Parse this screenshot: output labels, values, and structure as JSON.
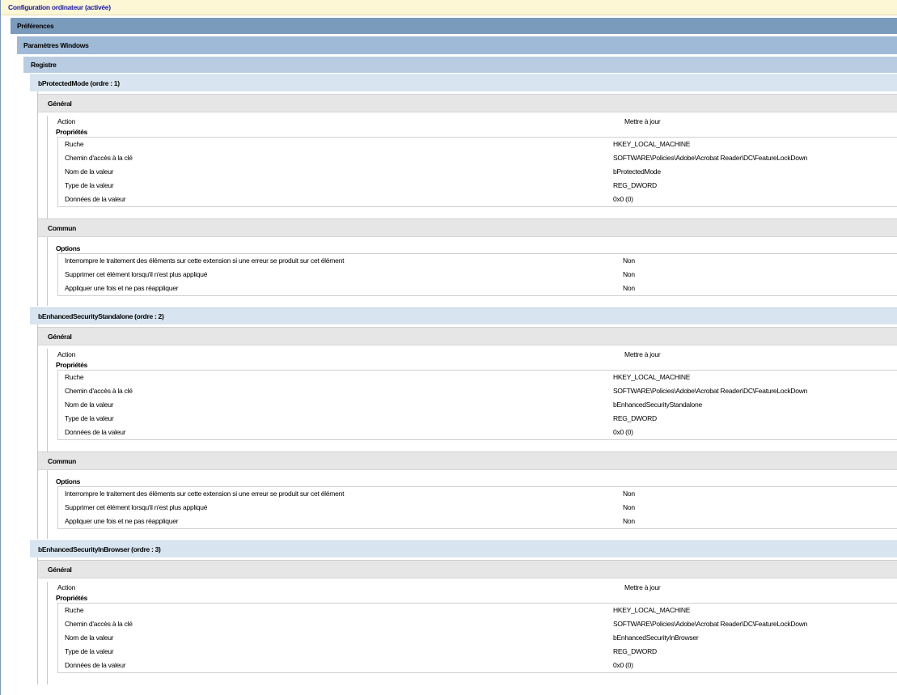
{
  "config_title": "Configuration ordinateur (activée)",
  "preferences": "Préférences",
  "windows_params": "Paramètres Windows",
  "registry": "Registre",
  "labels": {
    "general": "Général",
    "action": "Action",
    "properties": "Propriétés",
    "hive": "Ruche",
    "key_path": "Chemin d'accès à la clé",
    "value_name": "Nom de la valeur",
    "value_type": "Type de la valeur",
    "value_data": "Données de la valeur",
    "common": "Commun",
    "options": "Options",
    "opt_stop": "Interrompre le traitement des éléments sur cette extension si une erreur se produit sur cet élément",
    "opt_remove": "Supprimer cet élément lorsqu'il n'est plus appliqué",
    "opt_once": "Appliquer une fois et ne pas réappliquer"
  },
  "items": [
    {
      "title": "bProtectedMode (ordre : 1)",
      "action": "Mettre à jour",
      "hive": "HKEY_LOCAL_MACHINE",
      "key_path": "SOFTWARE\\Policies\\Adobe\\Acrobat Reader\\DC\\FeatureLockDown",
      "value_name": "bProtectedMode",
      "value_type": "REG_DWORD",
      "value_data": "0x0 (0)",
      "opt_stop": "Non",
      "opt_remove": "Non",
      "opt_once": "Non"
    },
    {
      "title": "bEnhancedSecurityStandalone (ordre : 2)",
      "action": "Mettre à jour",
      "hive": "HKEY_LOCAL_MACHINE",
      "key_path": "SOFTWARE\\Policies\\Adobe\\Acrobat Reader\\DC\\FeatureLockDown",
      "value_name": "bEnhancedSecurityStandalone",
      "value_type": "REG_DWORD",
      "value_data": "0x0 (0)",
      "opt_stop": "Non",
      "opt_remove": "Non",
      "opt_once": "Non"
    },
    {
      "title": "bEnhancedSecurityInBrowser (ordre : 3)",
      "action": "Mettre à jour",
      "hive": "HKEY_LOCAL_MACHINE",
      "key_path": "SOFTWARE\\Policies\\Adobe\\Acrobat Reader\\DC\\FeatureLockDown",
      "value_name": "bEnhancedSecurityInBrowser",
      "value_type": "REG_DWORD",
      "value_data": "0x0 (0)"
    }
  ]
}
